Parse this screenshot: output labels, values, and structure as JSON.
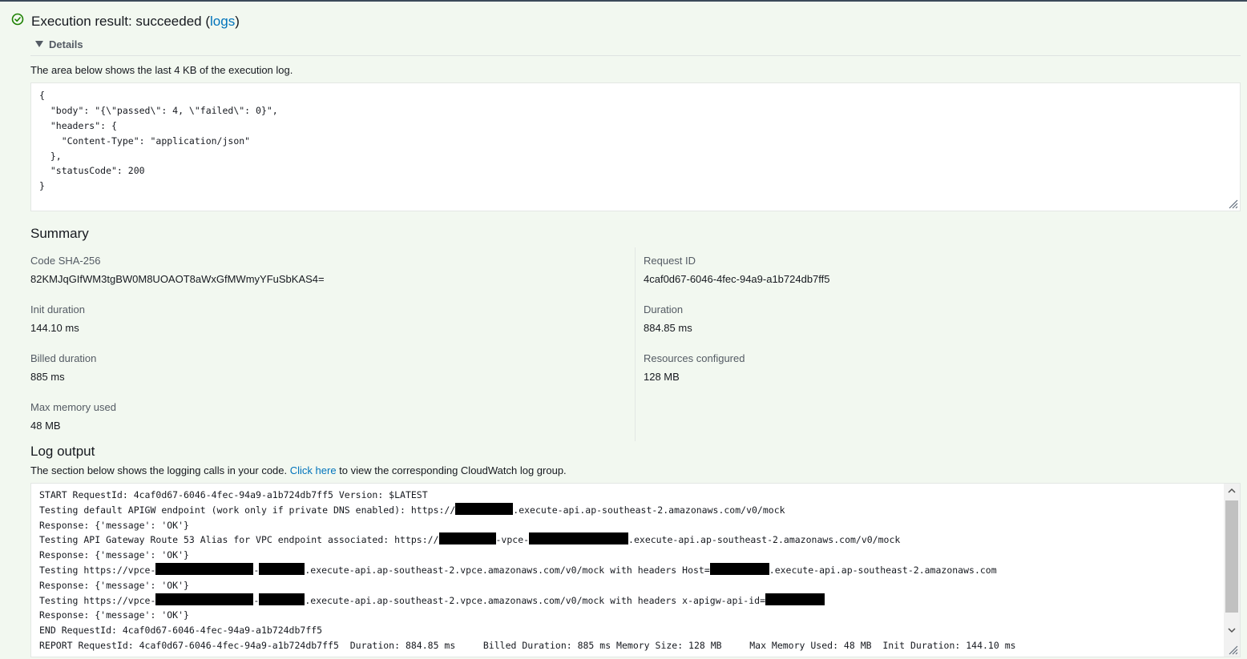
{
  "header": {
    "title_prefix": "Execution result: succeeded (",
    "logs_link": "logs",
    "title_suffix": ")"
  },
  "details": {
    "label": "Details"
  },
  "result": {
    "hint": "The area below shows the last 4 KB of the execution log.",
    "lines": [
      "{",
      "  \"body\": \"{\\\"passed\\\": 4, \\\"failed\\\": 0}\",",
      "  \"headers\": {",
      "    \"Content-Type\": \"application/json\"",
      "  },",
      "  \"statusCode\": 200",
      "}"
    ]
  },
  "summary": {
    "title": "Summary",
    "left": [
      {
        "label": "Code SHA-256",
        "value": "82KMJqGIfWM3tgBW0M8UOAOT8aWxGfMWmyYFuSbKAS4="
      },
      {
        "label": "Init duration",
        "value": "144.10 ms"
      },
      {
        "label": "Billed duration",
        "value": "885 ms"
      },
      {
        "label": "Max memory used",
        "value": "48 MB"
      }
    ],
    "right": [
      {
        "label": "Request ID",
        "value": "4caf0d67-6046-4fec-94a9-a1b724db7ff5"
      },
      {
        "label": "Duration",
        "value": "884.85 ms"
      },
      {
        "label": "Resources configured",
        "value": "128 MB"
      }
    ]
  },
  "log": {
    "title": "Log output",
    "hint_prefix": "The section below shows the logging calls in your code. ",
    "hint_link": "Click here",
    "hint_suffix": " to view the corresponding CloudWatch log group.",
    "lines": {
      "l1": "START RequestId: 4caf0d67-6046-4fec-94a9-a1b724db7ff5 Version: $LATEST",
      "l2a": "Testing default APIGW endpoint (work only if private DNS enabled): https://",
      "l2b": ".execute-api.ap-southeast-2.amazonaws.com/v0/mock",
      "l3": "Response: {'message': 'OK'}",
      "l4a": "Testing API Gateway Route 53 Alias for VPC endpoint associated: https://",
      "l4b": "-vpce-",
      "l4c": ".execute-api.ap-southeast-2.amazonaws.com/v0/mock",
      "l5": "Response: {'message': 'OK'}",
      "l6a": "Testing https://vpce-",
      "l6b": "-",
      "l6c": ".execute-api.ap-southeast-2.vpce.amazonaws.com/v0/mock with headers Host=",
      "l6d": ".execute-api.ap-southeast-2.amazonaws.com",
      "l7": "Response: {'message': 'OK'}",
      "l8a": "Testing https://vpce-",
      "l8b": "-",
      "l8c": ".execute-api.ap-southeast-2.vpce.amazonaws.com/v0/mock with headers x-apigw-api-id=",
      "l9": "Response: {'message': 'OK'}",
      "l10": "END RequestId: 4caf0d67-6046-4fec-94a9-a1b724db7ff5",
      "l11": "REPORT RequestId: 4caf0d67-6046-4fec-94a9-a1b724db7ff5  Duration: 884.85 ms     Billed Duration: 885 ms Memory Size: 128 MB     Max Memory Used: 48 MB  Init Duration: 144.10 ms"
    }
  },
  "colors": {
    "success": "#1d8102",
    "link": "#0073bb",
    "background": "#f2f8f0"
  },
  "icons": {
    "status": "check-circle-icon",
    "caret": "caret-down-icon",
    "resize": "resize-handle-icon"
  }
}
